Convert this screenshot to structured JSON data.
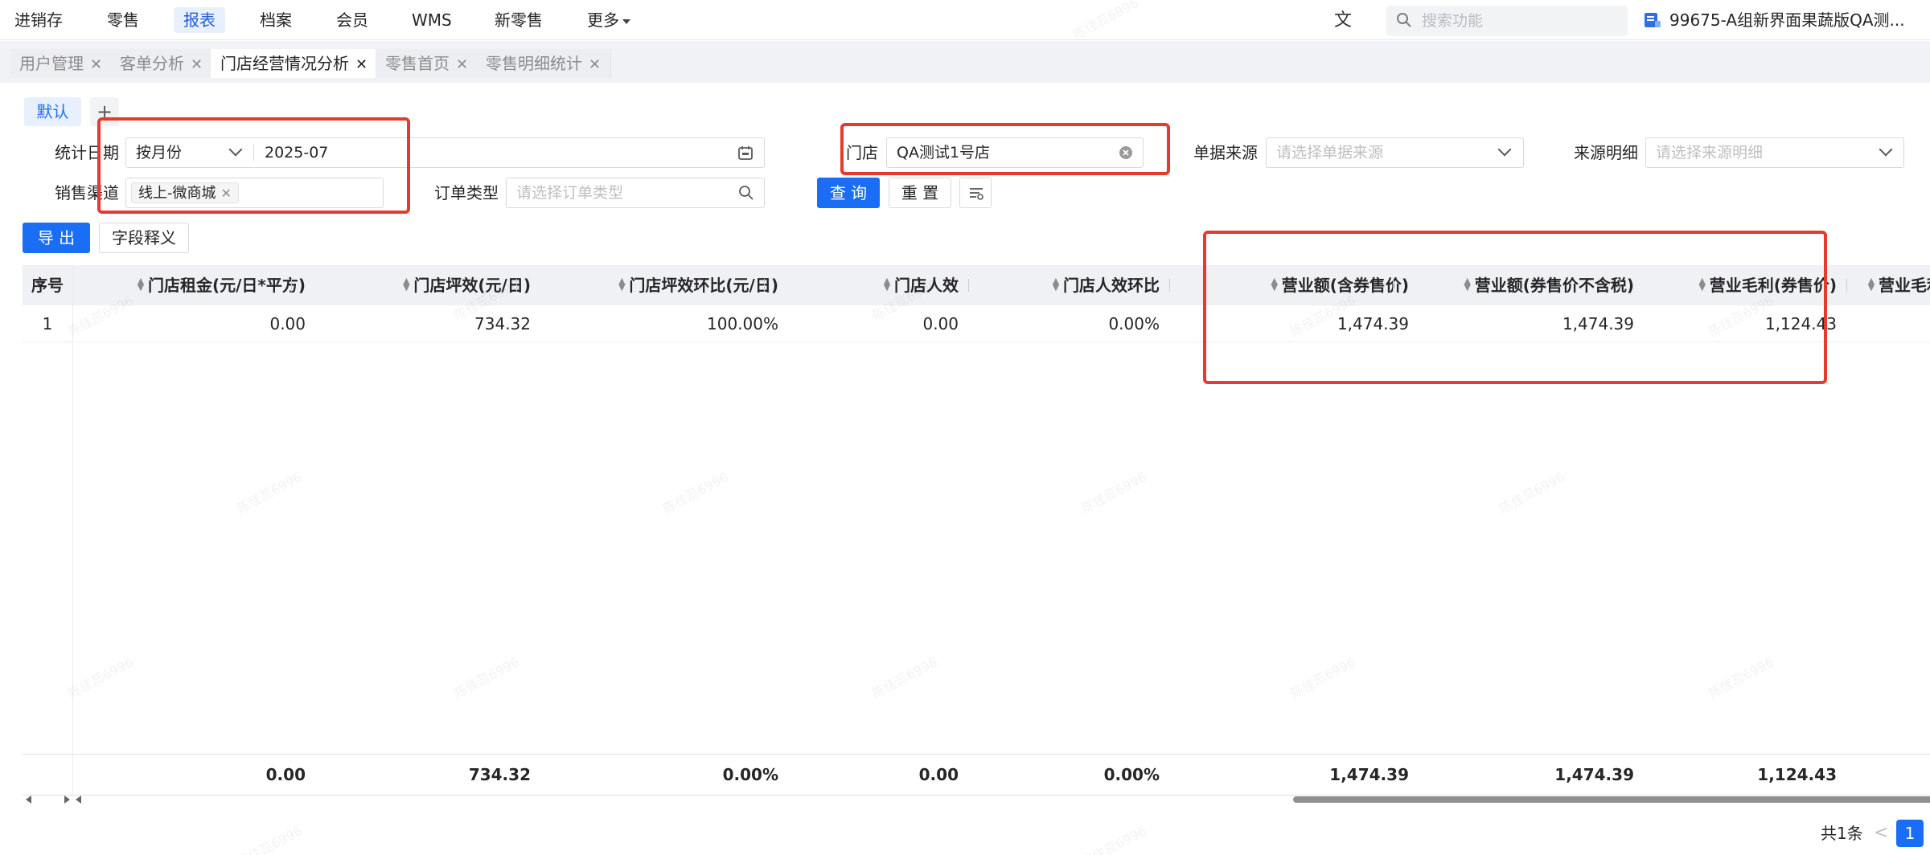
{
  "topnav": {
    "items": [
      "进销存",
      "零售",
      "报表",
      "档案",
      "会员",
      "WMS",
      "新零售",
      "更多"
    ],
    "active": "报表",
    "search_placeholder": "搜索功能",
    "store": "99675-A组新界面果蔬版QA测..."
  },
  "tabs": [
    {
      "label": "用户管理",
      "active": false
    },
    {
      "label": "客单分析",
      "active": false
    },
    {
      "label": "门店经营情况分析",
      "active": true
    },
    {
      "label": "零售首页",
      "active": false
    },
    {
      "label": "零售明细统计",
      "active": false
    }
  ],
  "filters": {
    "scheme_default": "默认",
    "scheme_add": "+",
    "stat_date_label": "统计日期",
    "stat_period": "按月份",
    "stat_month": "2025-07",
    "store_label": "门店",
    "store_value": "QA测试1号店",
    "doc_source_label": "单据来源",
    "doc_source_placeholder": "请选择单据来源",
    "source_detail_label": "来源明细",
    "source_detail_placeholder": "请选择来源明细",
    "channel_label": "销售渠道",
    "channel_tag": "线上-微商城",
    "order_type_label": "订单类型",
    "order_type_placeholder": "请选择订单类型",
    "query_button": "查 询",
    "reset_button": "重 置"
  },
  "toolbar": {
    "export_button": "导 出",
    "field_doc_button": "字段释义"
  },
  "table": {
    "seq_header": "序号",
    "columns": [
      "门店租金(元/日*平方)",
      "门店坪效(元/日)",
      "门店坪效环比(元/日)",
      "门店人效",
      "门店人效环比",
      "营业额(含券售价)",
      "营业额(券售价不含税)",
      "营业毛利(券售价)",
      "营业毛利"
    ],
    "rows": [
      {
        "seq": "1",
        "cells": [
          "0.00",
          "734.32",
          "100.00%",
          "0.00",
          "0.00%",
          "1,474.39",
          "1,474.39",
          "1,124.43"
        ]
      }
    ],
    "totals": [
      "0.00",
      "734.32",
      "0.00%",
      "0.00",
      "0.00%",
      "1,474.39",
      "1,474.39",
      "1,124.43"
    ]
  },
  "pagination": {
    "total": "共1条",
    "prev": "<",
    "page": "1"
  },
  "watermark": "陈佳蕊6996",
  "colors": {
    "primary": "#1a6ef5",
    "highlight": "#e53a2f"
  }
}
